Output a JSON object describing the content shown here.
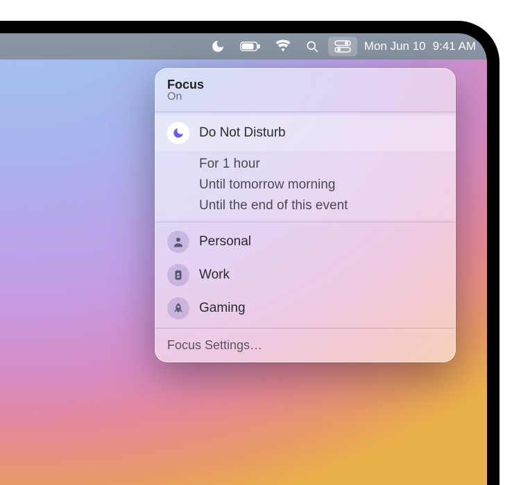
{
  "menubar": {
    "date": "Mon Jun 10",
    "time": "9:41 AM"
  },
  "focus": {
    "title": "Focus",
    "status": "On",
    "dnd_label": "Do Not Disturb",
    "durations": [
      "For 1 hour",
      "Until tomorrow morning",
      "Until the end of this event"
    ],
    "modes": [
      {
        "label": "Personal"
      },
      {
        "label": "Work"
      },
      {
        "label": "Gaming"
      }
    ],
    "settings_label": "Focus Settings…"
  }
}
